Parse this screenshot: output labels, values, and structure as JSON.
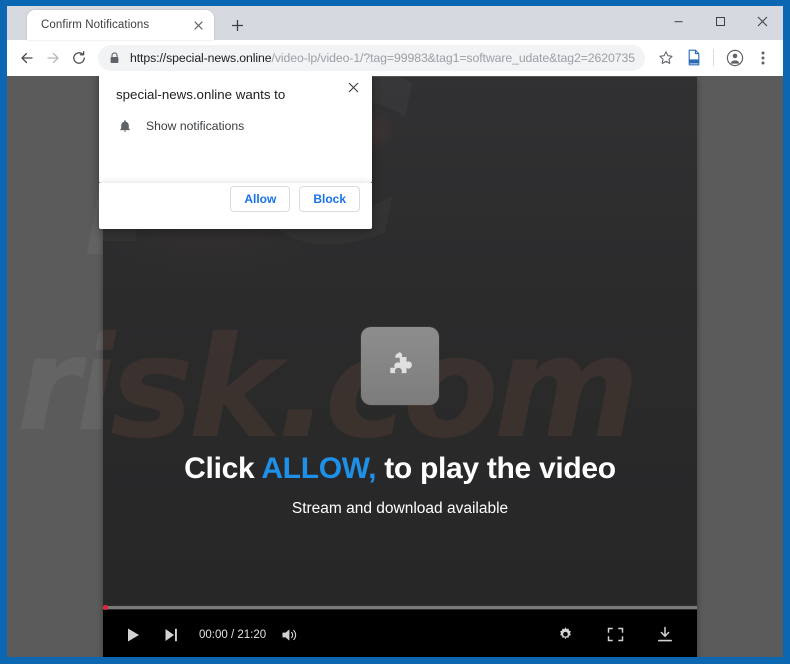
{
  "window": {
    "controls": {
      "minimize_label": "–",
      "maximize_label": "□",
      "close_label": "×"
    }
  },
  "tabs": {
    "active": {
      "title": "Confirm Notifications",
      "close_label": "×"
    },
    "new_tab_label": "+"
  },
  "toolbar": {
    "back_icon": "back-arrow-icon",
    "forward_icon": "forward-arrow-icon",
    "reload_icon": "reload-icon",
    "lock_icon": "lock-icon",
    "url_scheme_host": "https://special-news.online",
    "url_path": "/video-lp/video-1/?tag=99983&tag1=software_udate&tag2=2620735…",
    "bookmark_icon": "star-icon",
    "pdf_icon": "pdf-document-icon",
    "profile_icon": "profile-avatar-icon",
    "menu_icon": "three-dots-menu-icon"
  },
  "permission_dialog": {
    "title": "special-news.online wants to",
    "permission_icon": "bell-icon",
    "permission_label": "Show notifications",
    "allow_label": "Allow",
    "block_label": "Block",
    "close_label": "×"
  },
  "page": {
    "background_color": "#5b5b5b",
    "watermark_top": "PC",
    "watermark_bottom": "risk.com"
  },
  "video_player": {
    "placeholder_icon": "puzzle-piece-icon",
    "headline_prefix": "Click ",
    "headline_highlight": "ALLOW,",
    "headline_suffix": " to play the video",
    "highlight_color": "#1e90e8",
    "subline": "Stream and download available",
    "controls": {
      "play_icon": "play-icon",
      "next_icon": "next-track-icon",
      "time": "00:00 / 21:20",
      "volume_icon": "volume-icon",
      "settings_icon": "gear-icon",
      "fullscreen_icon": "fullscreen-icon",
      "download_icon": "download-icon"
    },
    "progress_percent": 0
  }
}
